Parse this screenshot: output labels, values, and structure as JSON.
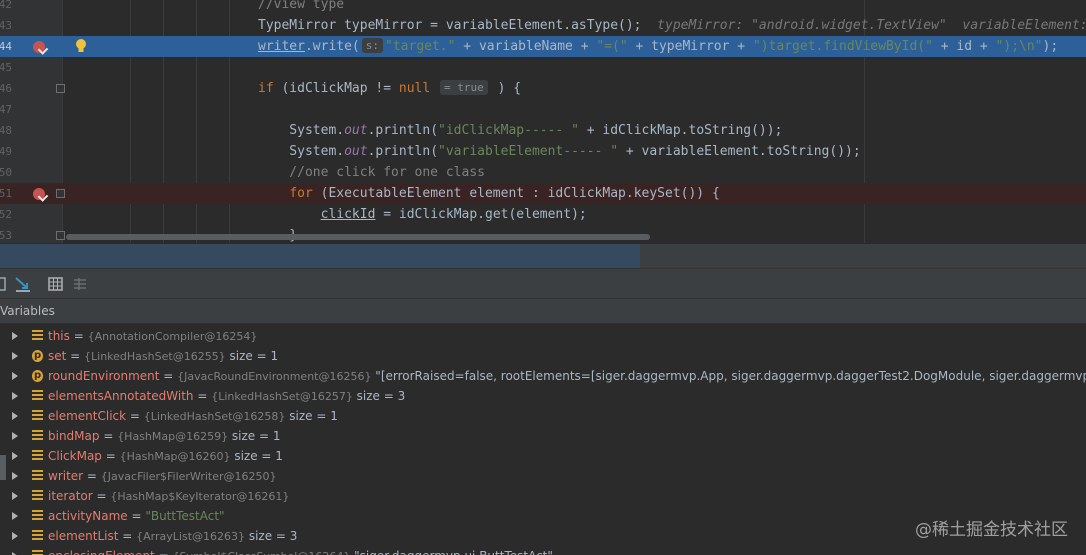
{
  "editor": {
    "lines": [
      {
        "num": "42",
        "parts": [
          {
            "t": "//view type",
            "c": "cm"
          }
        ]
      },
      {
        "num": "43",
        "parts": [
          {
            "t": "TypeMirror typeMirror = variableElement.asType();  ",
            "c": ""
          },
          {
            "t": "typeMirror: \"android.widget.TextView\"  variableElement: \"name\"",
            "c": "inl"
          }
        ]
      },
      {
        "num": "44",
        "parts": [
          {
            "t": "writer",
            "c": "ul"
          },
          {
            "t": ".write(",
            "c": ""
          },
          {
            "t": "s:",
            "c": "hint"
          },
          {
            "t": "\"target.\"",
            "c": "str"
          },
          {
            "t": " + variableName + ",
            "c": ""
          },
          {
            "t": "\"=(\"",
            "c": "str"
          },
          {
            "t": " + typeMirror + ",
            "c": ""
          },
          {
            "t": "\")target.findViewById(\"",
            "c": "str"
          },
          {
            "t": " + id + ",
            "c": ""
          },
          {
            "t": "\");\\n\"",
            "c": "str"
          },
          {
            "t": ");",
            "c": ""
          }
        ]
      },
      {
        "num": "45",
        "parts": []
      },
      {
        "num": "46",
        "parts": [
          {
            "t": "if",
            "c": "kw"
          },
          {
            "t": " (idClickMap != ",
            "c": ""
          },
          {
            "t": "null",
            "c": "kw"
          },
          {
            "t": " ",
            "c": ""
          },
          {
            "t": "= true",
            "c": "hint"
          },
          {
            "t": " ) {",
            "c": ""
          }
        ]
      },
      {
        "num": "47",
        "parts": []
      },
      {
        "num": "48",
        "parts": [
          {
            "t": "    System.",
            "c": ""
          },
          {
            "t": "out",
            "c": "fld"
          },
          {
            "t": ".println(",
            "c": ""
          },
          {
            "t": "\"idClickMap----- \"",
            "c": "str"
          },
          {
            "t": " + idClickMap.toString());",
            "c": ""
          }
        ]
      },
      {
        "num": "49",
        "parts": [
          {
            "t": "    System.",
            "c": ""
          },
          {
            "t": "out",
            "c": "fld"
          },
          {
            "t": ".println(",
            "c": ""
          },
          {
            "t": "\"variableElement----- \"",
            "c": "str"
          },
          {
            "t": " + variableElement.toString());",
            "c": ""
          }
        ]
      },
      {
        "num": "50",
        "parts": [
          {
            "t": "    //one click for one class",
            "c": "cm"
          }
        ]
      },
      {
        "num": "51",
        "parts": [
          {
            "t": "    ",
            "c": ""
          },
          {
            "t": "for",
            "c": "kw"
          },
          {
            "t": " (ExecutableElement element : idClickMap.keySet()) {",
            "c": ""
          }
        ]
      },
      {
        "num": "52",
        "parts": [
          {
            "t": "        ",
            "c": ""
          },
          {
            "t": "clickId",
            "c": "ul"
          },
          {
            "t": " = idClickMap.get(element);",
            "c": ""
          }
        ]
      },
      {
        "num": "53",
        "parts": [
          {
            "t": "    }",
            "c": ""
          }
        ]
      }
    ]
  },
  "debugger": {
    "panel_title": "Variables",
    "toolbar_icons": [
      "step-over-icon",
      "step-into-icon",
      "table-icon",
      "settings-icon"
    ]
  },
  "variables": [
    {
      "icon": "field",
      "name": "this",
      "obj": "{AnnotationCompiler@16254}",
      "extra": "",
      "extra_class": ""
    },
    {
      "icon": "param",
      "name": "set",
      "obj": "{LinkedHashSet@16255}",
      "extra": "size = 1",
      "extra_class": "vsize"
    },
    {
      "icon": "param",
      "name": "roundEnvironment",
      "obj": "{JavacRoundEnvironment@16256}",
      "extra": "\"[errorRaised=false, rootElements=[siger.daggermvp.App, siger.daggermvp.daggerTest2.DogModule, siger.daggermvp.d",
      "extra_class": "vlong"
    },
    {
      "icon": "field",
      "name": "elementsAnnotatedWith",
      "obj": "{LinkedHashSet@16257}",
      "extra": "size = 3",
      "extra_class": "vsize"
    },
    {
      "icon": "field",
      "name": "elementClick",
      "obj": "{LinkedHashSet@16258}",
      "extra": "size = 1",
      "extra_class": "vsize"
    },
    {
      "icon": "field",
      "name": "bindMap",
      "obj": "{HashMap@16259}",
      "extra": "size = 1",
      "extra_class": "vsize"
    },
    {
      "icon": "field",
      "name": "ClickMap",
      "obj": "{HashMap@16260}",
      "extra": "size = 1",
      "extra_class": "vsize"
    },
    {
      "icon": "field",
      "name": "writer",
      "obj": "{JavacFiler$FilerWriter@16250}",
      "extra": "",
      "extra_class": ""
    },
    {
      "icon": "field",
      "name": "iterator",
      "obj": "{HashMap$KeyIterator@16261}",
      "extra": "",
      "extra_class": ""
    },
    {
      "icon": "field",
      "name": "activityName",
      "obj": "\"ButtTestAct\"",
      "extra": "",
      "extra_class": ""
    },
    {
      "icon": "field",
      "name": "elementList",
      "obj": "{ArrayList@16263}",
      "extra": "size = 3",
      "extra_class": "vsize"
    },
    {
      "icon": "field",
      "name": "enclosingElement",
      "obj": "{Symbol$ClassSymbol@16264}",
      "extra": "\"siger.daggermvp.ui.ButtTestAct\"",
      "extra_class": "vlong"
    }
  ],
  "watermark": "@稀土掘金技术社区",
  "colors": {
    "execution_line": "#2d6099",
    "breakpoint_line": "#3a2323",
    "breakpoint": "#c75450",
    "editor_bg": "#2b2b2b"
  }
}
